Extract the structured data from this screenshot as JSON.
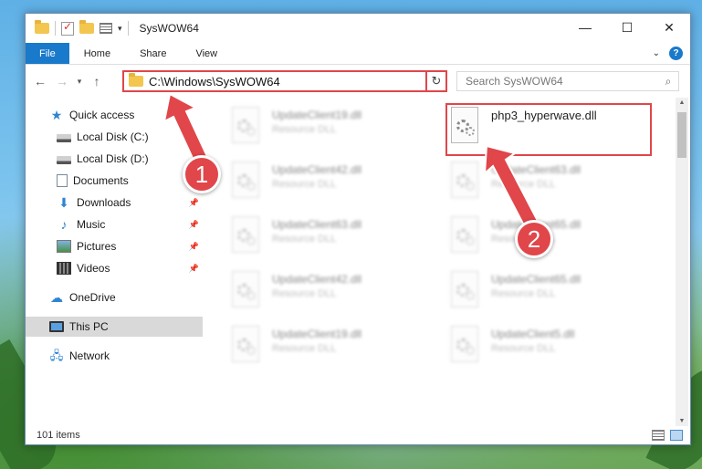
{
  "window": {
    "title": "SysWOW64",
    "controls": {
      "minimize": "—",
      "maximize": "☐",
      "close": "✕"
    }
  },
  "ribbon": {
    "tabs": [
      {
        "label": "File"
      },
      {
        "label": "Home"
      },
      {
        "label": "Share"
      },
      {
        "label": "View"
      }
    ],
    "help": "?"
  },
  "nav": {
    "back": "←",
    "forward": "→",
    "recent": "▾",
    "up": "↑",
    "address": "C:\\Windows\\SysWOW64",
    "address_dropdown": "▾",
    "refresh": "↻",
    "search_placeholder": "Search SysWOW64",
    "search_icon": "⌕"
  },
  "sidebar": {
    "items": [
      {
        "label": "Quick access",
        "icon": "star-icon",
        "pinned": false
      },
      {
        "label": "Local Disk (C:)",
        "icon": "disk-icon",
        "pinned": false
      },
      {
        "label": "Local Disk (D:)",
        "icon": "disk-icon",
        "pinned": false
      },
      {
        "label": "Documents",
        "icon": "documents-icon",
        "pinned": true
      },
      {
        "label": "Downloads",
        "icon": "download-icon",
        "pinned": true
      },
      {
        "label": "Music",
        "icon": "music-icon",
        "pinned": true
      },
      {
        "label": "Pictures",
        "icon": "pictures-icon",
        "pinned": true
      },
      {
        "label": "Videos",
        "icon": "videos-icon",
        "pinned": true
      },
      {
        "label": "OneDrive",
        "icon": "cloud-icon",
        "pinned": false
      },
      {
        "label": "This PC",
        "icon": "pc-icon",
        "pinned": false,
        "selected": true
      },
      {
        "label": "Network",
        "icon": "network-icon",
        "pinned": false
      }
    ],
    "pin_glyph": "📌"
  },
  "files": {
    "highlighted": {
      "name": "php3_hyperwave.dll",
      "type": ""
    },
    "blurred": [
      {
        "name": "UpdateClient19.dll",
        "type": "Resource DLL"
      },
      {
        "name": "UpdateClient42.dll",
        "type": "Resource DLL"
      },
      {
        "name": "UpdateClient63.dll",
        "type": "Resource DLL"
      },
      {
        "name": "UpdateClient63.dll",
        "type": "Resource DLL"
      },
      {
        "name": "UpdateClient65.dll",
        "type": "Resource DLL"
      },
      {
        "name": "UpdateClient42.dll",
        "type": "Resource DLL"
      },
      {
        "name": "UpdateClient65.dll",
        "type": "Resource DLL"
      },
      {
        "name": "UpdateClient19.dll",
        "type": "Resource DLL"
      },
      {
        "name": "UpdateClient5.dll",
        "type": "Resource DLL"
      }
    ]
  },
  "status": {
    "item_count": "101 items"
  },
  "annotations": {
    "step1": "1",
    "step2": "2",
    "color": "#e0464a"
  }
}
